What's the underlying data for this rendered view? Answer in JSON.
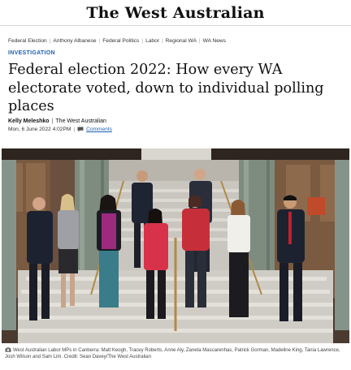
{
  "masthead": {
    "logo_text": "The West Australian"
  },
  "tags": [
    "Federal Election",
    "Anthony Albanese",
    "Federal Politics",
    "Labor",
    "Regional WA",
    "WA News"
  ],
  "category": "INVESTIGATION",
  "headline": "Federal election 2022: How every WA electorate voted, down to individual polling places",
  "byline": {
    "author": "Kelly Meleshko",
    "publication": "The West Australian"
  },
  "dateline": {
    "date": "Mon, 6 June 2022 4:02PM",
    "comments_label": "Comments"
  },
  "image": {
    "caption": "West Australian Labor MPs in Canberra: Matt Keogh, Tracey Roberts, Anne Aly, Zaneta Mascarenhas, Patrick Gorman, Madeline King, Tania Lawrence, Josh Wilson and Sam Lim. Credit: Sean Davey/The West Australian"
  },
  "colors": {
    "link": "#1a5fb4",
    "text": "#111111",
    "divider": "#d7d7d7"
  }
}
